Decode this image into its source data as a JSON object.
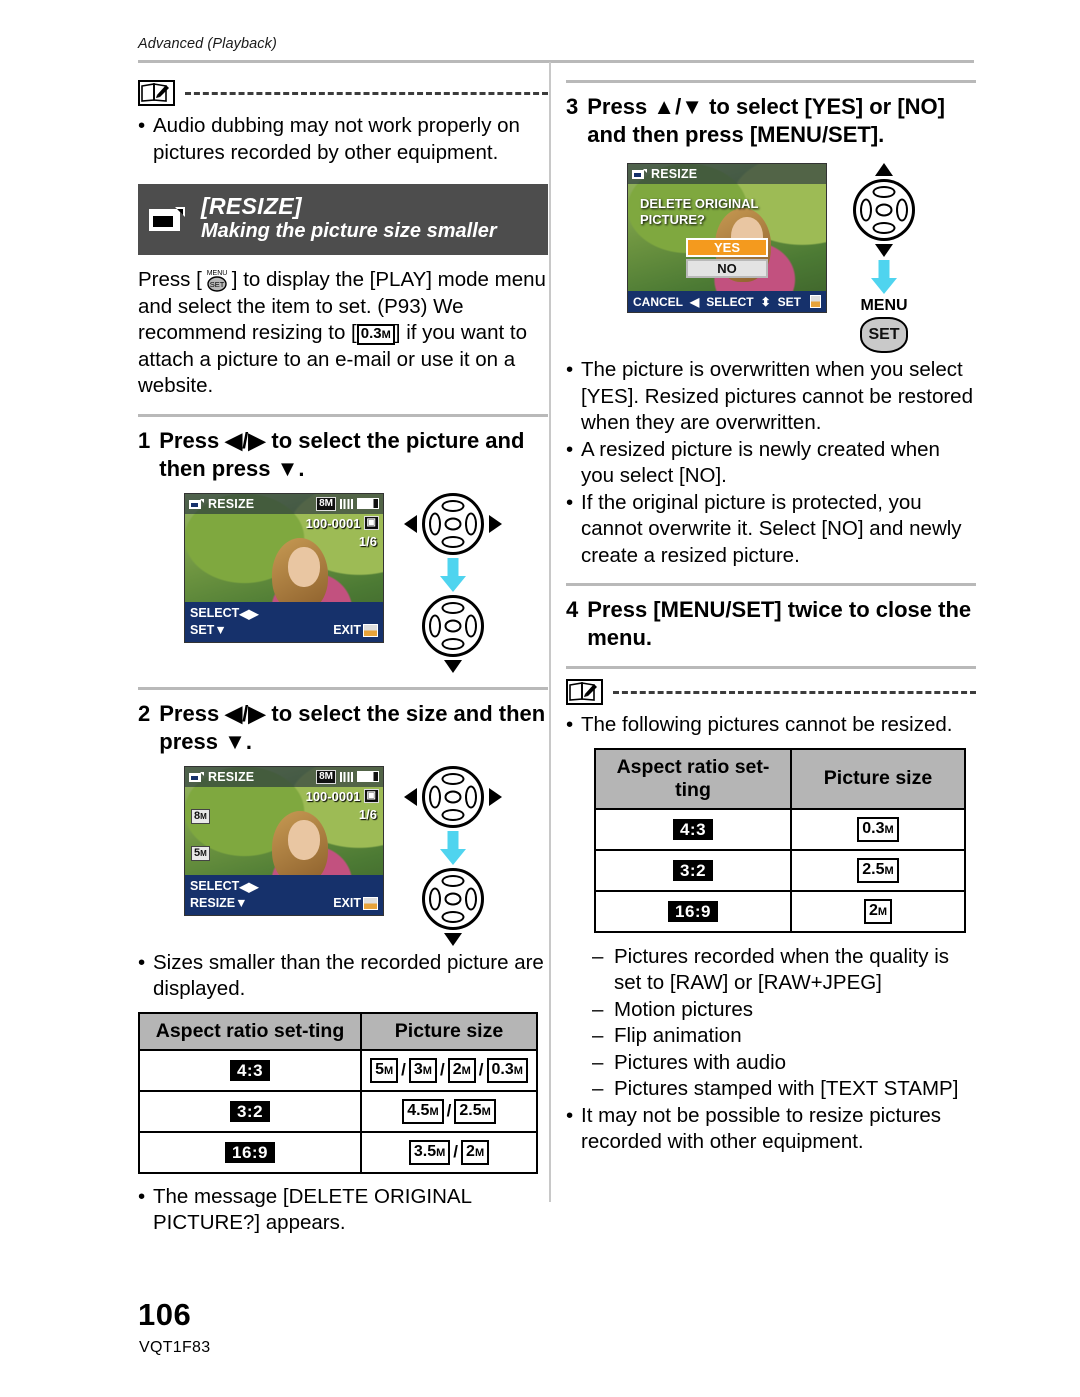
{
  "header": {
    "running_head": "Advanced (Playback)"
  },
  "footer": {
    "page_number": "106",
    "model_code": "VQT1F83"
  },
  "left_column": {
    "top_note": {
      "icon": "note-book-pencil-icon",
      "bullets": [
        "Audio dubbing may not work properly on pictures recorded by other equipment."
      ]
    },
    "banner": {
      "icon": "resize-icon",
      "title": "[RESIZE]",
      "subtitle": "Making the picture size smaller"
    },
    "intro_parts": {
      "p1": "Press [",
      "menu_icon": "menu-set-icon",
      "p2": "] to display the [PLAY] mode menu and select the item to set. (P93) We recommend resizing to [",
      "size_badge": "0.3",
      "size_badge_unit": "M",
      "p3": "] if you want to attach a picture to an e-mail or use it on a website."
    },
    "step1": {
      "number": "1",
      "text": "Press ◀/▶ to select the picture and then press ▼."
    },
    "figure1": {
      "lcd": {
        "title": "RESIZE",
        "picture_size_badge": "8M",
        "quality_icon": "quality-icon",
        "battery_icon": "battery-icon",
        "file_number": "100-0001",
        "folder_icon": "folder-icon",
        "frame_count": "1/6",
        "footer_left_top": "SELECT",
        "footer_left_top_icon": "◀▶",
        "footer_left_bottom": "SET",
        "footer_left_bottom_icon": "▼",
        "footer_right": "EXIT",
        "footer_right_icon": "menu-icon"
      },
      "dpad_top_left_icon": "◀",
      "dpad_top_right_icon": "▶",
      "cyan_arrow_icon": "down-arrow-icon",
      "dpad_bottom_icon": "▼"
    },
    "step2": {
      "number": "2",
      "text": "Press ◀/▶ to select the size and then press ▼."
    },
    "figure2": {
      "lcd": {
        "title": "RESIZE",
        "picture_size_badge": "8M",
        "quality_icon": "quality-icon",
        "battery_icon": "battery-icon",
        "file_number": "100-0001",
        "folder_icon": "folder-icon",
        "frame_count": "1/6",
        "size_option_1": "8",
        "size_option_1_unit": "M",
        "size_option_2": "5",
        "size_option_2_unit": "M",
        "footer_left_top": "SELECT",
        "footer_left_top_icon": "◀▶",
        "footer_left_bottom": "RESIZE",
        "footer_left_bottom_icon": "▼",
        "footer_right": "EXIT",
        "footer_right_icon": "menu-icon"
      }
    },
    "bullet_sizes": "Sizes smaller than the recorded picture are displayed.",
    "table": {
      "headers": [
        "Aspect ratio set-ting",
        "Picture size"
      ],
      "rows": [
        {
          "ratio": "4:3",
          "sizes": [
            {
              "v": "5",
              "u": "M"
            },
            {
              "v": "3",
              "u": "M"
            },
            {
              "v": "2",
              "u": "M"
            },
            {
              "v": "0.3",
              "u": "M"
            }
          ]
        },
        {
          "ratio": "3:2",
          "sizes": [
            {
              "v": "4.5",
              "u": "M"
            },
            {
              "v": "2.5",
              "u": "M"
            }
          ]
        },
        {
          "ratio": "16:9",
          "sizes": [
            {
              "v": "3.5",
              "u": "M"
            },
            {
              "v": "2",
              "u": "M"
            }
          ]
        }
      ]
    },
    "bullet_message": "The message [DELETE ORIGINAL PICTURE?] appears."
  },
  "right_column": {
    "step3": {
      "number": "3",
      "text": "Press ▲/▼ to select [YES] or [NO] and then press [MENU/SET]."
    },
    "figure3": {
      "lcd": {
        "title": "RESIZE",
        "message_line1": "DELETE ORIGINAL",
        "message_line2": "PICTURE?",
        "choice_yes": "YES",
        "choice_no": "NO",
        "footer_cancel": "CANCEL",
        "footer_cancel_icon": "◀",
        "footer_select": "SELECT",
        "footer_select_icon": "⬍",
        "footer_set": "SET",
        "footer_set_icon": "menu-icon"
      },
      "dpad_up_icon": "▲",
      "dpad_down_icon": "▼",
      "cyan_arrow_icon": "down-arrow-icon",
      "menu_label": "MENU",
      "set_label": "SET"
    },
    "bullets": [
      "The picture is overwritten when you select [YES]. Resized pictures cannot be restored when they are overwritten.",
      "A resized picture is newly created when you select [NO].",
      "If the original picture is protected, you cannot overwrite it. Select [NO] and newly create a resized picture."
    ],
    "step4": {
      "number": "4",
      "text": "Press [MENU/SET] twice to close the menu."
    },
    "bottom_note": {
      "icon": "note-book-pencil-icon",
      "intro_bullet": "The following pictures cannot be resized.",
      "table": {
        "headers": [
          "Aspect ratio set-ting",
          "Picture size"
        ],
        "rows": [
          {
            "ratio": "4:3",
            "sizes": [
              {
                "v": "0.3",
                "u": "M"
              }
            ]
          },
          {
            "ratio": "3:2",
            "sizes": [
              {
                "v": "2.5",
                "u": "M"
              }
            ]
          },
          {
            "ratio": "16:9",
            "sizes": [
              {
                "v": "2",
                "u": "M"
              }
            ]
          }
        ]
      },
      "dash_items": [
        "Pictures recorded when the quality is set to [RAW] or [RAW+JPEG]",
        "Motion pictures",
        "Flip animation",
        "Pictures with audio",
        "Pictures stamped with [TEXT STAMP]"
      ],
      "final_bullet": "It may not be possible to resize pictures recorded with other equipment."
    }
  },
  "colors": {
    "banner_bg": "#4d4d4d",
    "table_header_bg": "#b5b5b5",
    "lcd_footer_blue": "#16316b",
    "highlight_orange": "#f49a1e",
    "cyan_arrow": "#4fd4ef"
  }
}
